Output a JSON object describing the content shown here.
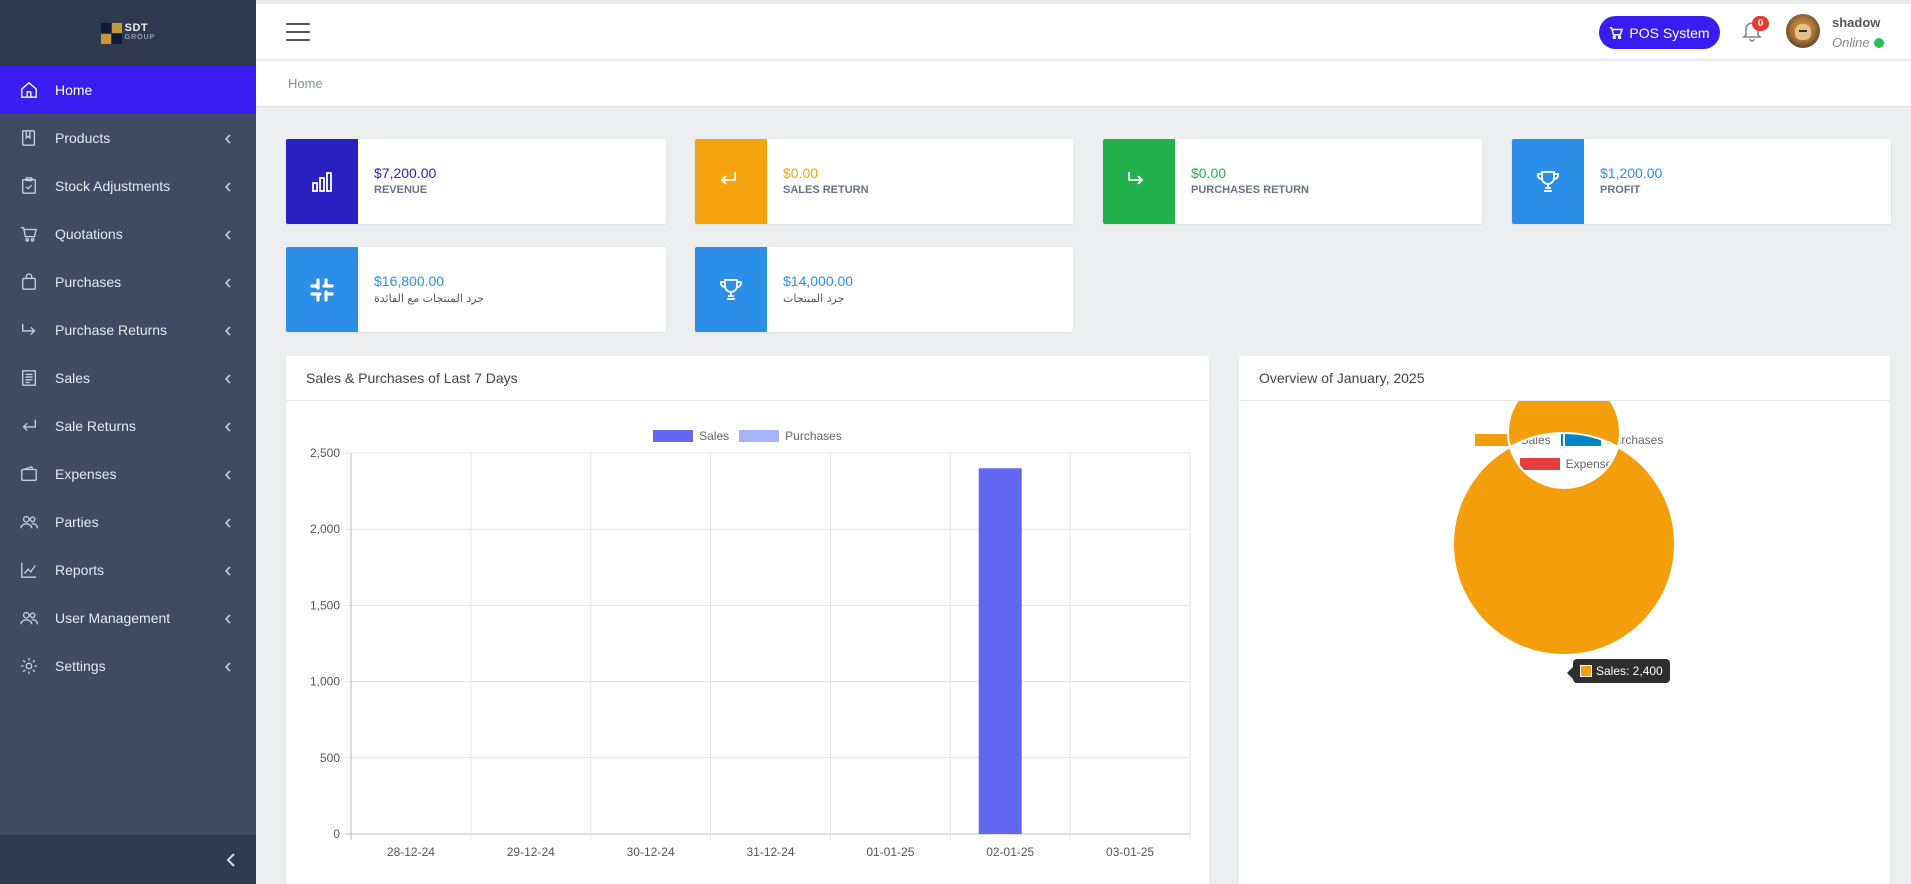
{
  "brand": {
    "logo_text": "SDT",
    "logo_sub": "GROUP"
  },
  "sidebar": {
    "items": [
      {
        "label": "Home",
        "icon": "home-icon",
        "active": true,
        "has_children": false
      },
      {
        "label": "Products",
        "icon": "book-icon",
        "active": false,
        "has_children": true
      },
      {
        "label": "Stock Adjustments",
        "icon": "clipboard-check-icon",
        "active": false,
        "has_children": true
      },
      {
        "label": "Quotations",
        "icon": "cart-icon",
        "active": false,
        "has_children": true
      },
      {
        "label": "Purchases",
        "icon": "bag-icon",
        "active": false,
        "has_children": true
      },
      {
        "label": "Purchase Returns",
        "icon": "arrow-return-right-icon",
        "active": false,
        "has_children": true
      },
      {
        "label": "Sales",
        "icon": "receipt-icon",
        "active": false,
        "has_children": true
      },
      {
        "label": "Sale Returns",
        "icon": "arrow-return-left-icon",
        "active": false,
        "has_children": true
      },
      {
        "label": "Expenses",
        "icon": "wallet-icon",
        "active": false,
        "has_children": true
      },
      {
        "label": "Parties",
        "icon": "people-icon",
        "active": false,
        "has_children": true
      },
      {
        "label": "Reports",
        "icon": "graph-up-icon",
        "active": false,
        "has_children": true
      },
      {
        "label": "User Management",
        "icon": "people-icon",
        "active": false,
        "has_children": true
      },
      {
        "label": "Settings",
        "icon": "gear-icon",
        "active": false,
        "has_children": true
      }
    ]
  },
  "topbar": {
    "pos_label": "POS System",
    "notification_count": "0",
    "user_name": "shadow",
    "user_status": "Online"
  },
  "breadcrumb": {
    "current": "Home"
  },
  "stats": [
    {
      "value": "$7,200.00",
      "label": "REVENUE",
      "color": "#2a1fc0",
      "icon": "bar-chart-icon"
    },
    {
      "value": "$0.00",
      "label": "SALES RETURN",
      "color": "#f5a30f",
      "icon": "arrow-return-left-icon"
    },
    {
      "value": "$0.00",
      "label": "PURCHASES RETURN",
      "color": "#22b14c",
      "icon": "arrow-return-right-icon"
    },
    {
      "value": "$1,200.00",
      "label": "PROFIT",
      "color": "#2b8fe8",
      "icon": "trophy-icon"
    },
    {
      "value": "$16,800.00",
      "label": "جرد المنتجات مع الفائدة",
      "color": "#2b8fe8",
      "icon": "slack-icon"
    },
    {
      "value": "$14,000.00",
      "label": "جرد المنتجات",
      "color": "#2b8fe8",
      "icon": "trophy-icon"
    }
  ],
  "colors": {
    "accent": "#3b1cf0",
    "sidebar": "#3e4b63",
    "sidebar_dark": "#2f3a4f"
  },
  "chart_data": [
    {
      "type": "bar",
      "title": "Sales & Purchases of Last 7 Days",
      "categories": [
        "28-12-24",
        "29-12-24",
        "30-12-24",
        "31-12-24",
        "01-01-25",
        "02-01-25",
        "03-01-25"
      ],
      "series": [
        {
          "name": "Sales",
          "color": "#6366f1",
          "values": [
            0,
            0,
            0,
            0,
            0,
            2400,
            0
          ]
        },
        {
          "name": "Purchases",
          "color": "#a5b4fc",
          "values": [
            0,
            0,
            0,
            0,
            0,
            0,
            0
          ]
        }
      ],
      "ylim": [
        0,
        2500
      ],
      "yticks": [
        "2,500",
        "2,000",
        "1,500",
        "1,000",
        "500",
        "0"
      ],
      "ytick_values": [
        2500,
        2000,
        1500,
        1000,
        500,
        0
      ],
      "grid": true,
      "legend": "top"
    },
    {
      "type": "pie",
      "title": "Overview of January, 2025",
      "labels": [
        "Sales",
        "Purchases",
        "Expenses"
      ],
      "values": [
        2400,
        0,
        0
      ],
      "colors": [
        "#f59e0b",
        "#0284c7",
        "#e53e3e"
      ],
      "legend": "top",
      "tooltip": "Sales: 2,400"
    }
  ]
}
